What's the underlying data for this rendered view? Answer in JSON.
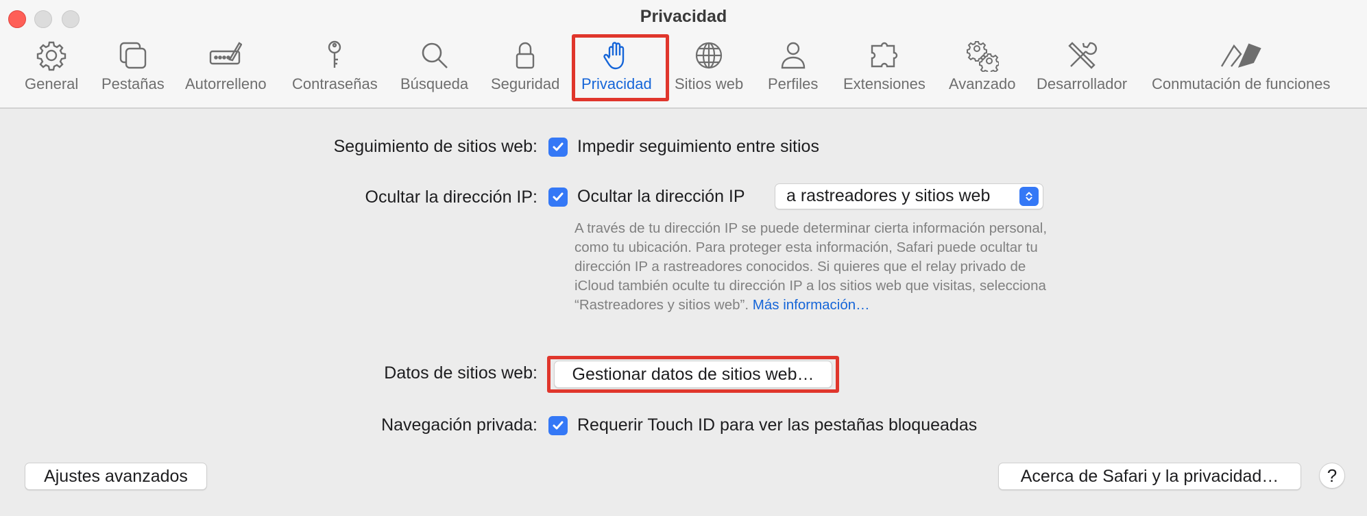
{
  "window": {
    "title": "Privacidad"
  },
  "tabs": [
    {
      "label": "General",
      "icon": "gear-icon"
    },
    {
      "label": "Pestañas",
      "icon": "tabs-icon"
    },
    {
      "label": "Autorrelleno",
      "icon": "autofill-icon"
    },
    {
      "label": "Contraseñas",
      "icon": "key-icon"
    },
    {
      "label": "Búsqueda",
      "icon": "magnifier-icon"
    },
    {
      "label": "Seguridad",
      "icon": "lock-icon"
    },
    {
      "label": "Privacidad",
      "icon": "hand-icon"
    },
    {
      "label": "Sitios web",
      "icon": "globe-icon"
    },
    {
      "label": "Perfiles",
      "icon": "person-icon"
    },
    {
      "label": "Extensiones",
      "icon": "puzzle-icon"
    },
    {
      "label": "Avanzado",
      "icon": "gears-icon"
    },
    {
      "label": "Desarrollador",
      "icon": "tools-icon"
    },
    {
      "label": "Conmutación de funciones",
      "icon": "flags-icon"
    }
  ],
  "active_tab": "Privacidad",
  "colors": {
    "accent": "#3478f6",
    "link": "#1565d8",
    "highlight_box": "#e0362c",
    "close_button": "#fe5f57"
  },
  "privacy": {
    "tracking": {
      "label": "Seguimiento de sitios web:",
      "checkbox_label": "Impedir seguimiento entre sitios",
      "checked": true
    },
    "hide_ip": {
      "label": "Ocultar la dirección IP:",
      "checkbox_label": "Ocultar la dirección IP",
      "checked": true,
      "select_value": "a rastreadores y sitios web",
      "description": "A través de tu dirección IP se puede determinar cierta información personal, como tu ubicación. Para proteger esta información, Safari puede ocultar tu dirección IP a rastreadores conocidos. Si quieres que el relay privado de iCloud también oculte tu dirección IP a los sitios web que visitas, selecciona “Rastreadores y sitios web”.",
      "more_info_link": "Más información…"
    },
    "website_data": {
      "label": "Datos de sitios web:",
      "button_label": "Gestionar datos de sitios web…"
    },
    "private_browsing": {
      "label": "Navegación privada:",
      "checkbox_label": "Requerir Touch ID para ver las pestañas bloqueadas",
      "checked": true
    }
  },
  "footer": {
    "advanced_button": "Ajustes avanzados",
    "about_button": "Acerca de Safari y la privacidad…",
    "help_button": "?"
  }
}
